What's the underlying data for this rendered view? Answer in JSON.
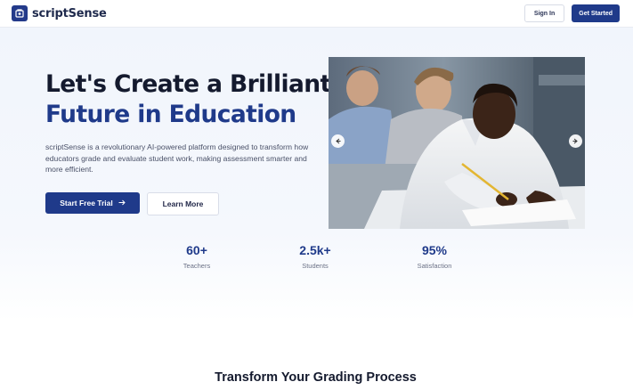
{
  "header": {
    "brand_name": "scriptSense",
    "signin_label": "Sign In",
    "getstarted_label": "Get Started"
  },
  "hero": {
    "title_line1": "Let's Create a Brilliant",
    "title_line2": "Future in Education",
    "description": "scriptSense is a revolutionary AI-powered platform designed to transform how educators grade and evaluate student work, making assessment smarter and more efficient.",
    "primary_cta": "Start Free Trial",
    "secondary_cta": "Learn More"
  },
  "carousel": {
    "image_alt": "Students writing an exam in a classroom",
    "prev_icon": "chevron-left-icon",
    "next_icon": "chevron-right-icon"
  },
  "stats": [
    {
      "value": "60+",
      "label": "Teachers"
    },
    {
      "value": "2.5k+",
      "label": "Students"
    },
    {
      "value": "95%",
      "label": "Satisfaction"
    }
  ],
  "features": {
    "section_title": "Transform Your Grading Process"
  },
  "colors": {
    "brand": "#1f3a8a",
    "heading": "#141a2e",
    "hero_bg": "#f1f5fc"
  }
}
